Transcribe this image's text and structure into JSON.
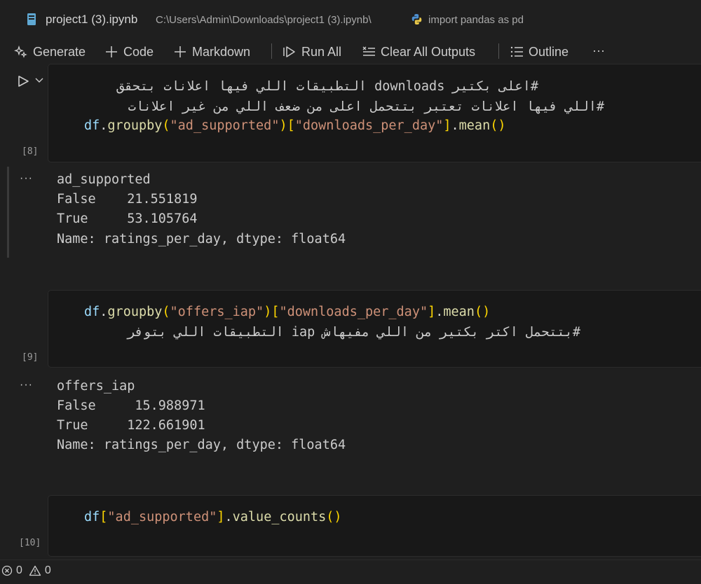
{
  "breadcrumb": {
    "file_name": "project1 (3).ipynb",
    "path": "C:\\Users\\Admin\\Downloads\\project1 (3).ipynb\\",
    "symbol": "import pandas as pd"
  },
  "toolbar": {
    "generate": "Generate",
    "code": "Code",
    "markdown": "Markdown",
    "run_all": "Run All",
    "clear_outputs": "Clear All Outputs",
    "outline": "Outline",
    "more": "···"
  },
  "cells": [
    {
      "exec_count": "[8]",
      "line1_comment": "#اعلى بكتير downloads التطبيقات اللي فيها اعلانات بتحقق",
      "line2_comment": "#اللي فيها اعلانات تعتبر بتتحمل اعلى من ضعف اللي من غير اعلانات",
      "code": {
        "obj": "df",
        "dot1": ".",
        "method": "groupby",
        "arg": "\"ad_supported\"",
        "key": "\"downloads_per_day\"",
        "dot2": ".",
        "agg": "mean"
      },
      "output": {
        "header": "ad_supported",
        "row1": "False    21.551819",
        "row2": "True     53.105764",
        "footer": "Name: ratings_per_day, dtype: float64"
      }
    },
    {
      "exec_count": "[9]",
      "code": {
        "obj": "df",
        "dot1": ".",
        "method": "groupby",
        "arg": "\"offers_iap\"",
        "key": "\"downloads_per_day\"",
        "dot2": ".",
        "agg": "mean"
      },
      "line2_comment": "#بتتحمل اكتر بكتير من اللي مفيهاش iap التطبيقات اللي بتوفر",
      "output": {
        "header": "offers_iap",
        "row1": "False     15.988971",
        "row2": "True     122.661901",
        "footer": "Name: ratings_per_day, dtype: float64"
      }
    },
    {
      "exec_count": "[10]",
      "code": {
        "obj": "df",
        "key": "\"ad_supported\"",
        "dot": ".",
        "method": "value_counts"
      }
    }
  ],
  "output_ellipsis": "···",
  "status": {
    "errors": "0",
    "warnings": "0"
  },
  "colors": {
    "background": "#1f1f1f",
    "cell_bg": "#181818",
    "string": "#ce9178",
    "function": "#dcdcaa",
    "variable": "#9cdcfe",
    "bracket1": "#ffd700",
    "bracket2": "#da70d6"
  }
}
